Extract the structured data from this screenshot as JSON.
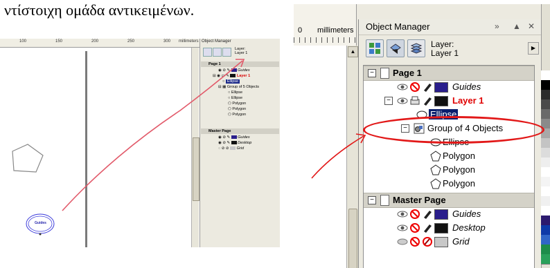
{
  "caption": "ντίστοιχη ομάδα αντικειμένων.",
  "left_screenshot": {
    "ruler_numbers": [
      "100",
      "150",
      "200",
      "250",
      "300"
    ],
    "ruler_unit": "millimeters",
    "panel_title": "Object Manager",
    "layer_line1": "Layer:",
    "layer_line2": "Layer 1",
    "tree": {
      "page": "Page 1",
      "guides": "Guides",
      "layer": "Layer 1",
      "ellipse_selected": "Ellipse",
      "group": "Group of 5 Objects",
      "children": [
        "Ellipse",
        "Ellipse",
        "Polygon",
        "Polygon",
        "Polygon"
      ],
      "master": "Master Page",
      "master_items": [
        "Guides",
        "Desktop",
        "Grid"
      ]
    },
    "canvas_label": "Guides"
  },
  "right_screenshot": {
    "ruler_number": "0",
    "ruler_unit": "millimeters",
    "panel_title": "Object Manager",
    "title_buttons": [
      "»",
      "▲",
      "✕"
    ],
    "layer_line1": "Layer:",
    "layer_line2": "Layer 1",
    "tree": {
      "page": "Page 1",
      "guides": "Guides",
      "layer": "Layer 1",
      "ellipse_selected": "Ellipse",
      "group": "Group of 4 Objects",
      "children": [
        "Ellipse",
        "Polygon",
        "Polygon",
        "Polygon"
      ],
      "master": "Master Page",
      "master_items": [
        "Guides",
        "Desktop",
        "Grid"
      ]
    }
  },
  "colors": {
    "accent_red": "#e21818",
    "selection_blue": "#0a1f6e",
    "guides_swatch": "#2a1e8c",
    "layer_swatch": "#111111",
    "grid_swatch": "#c8c8c8",
    "layer_text_red": "#e00000"
  },
  "icons": [
    "eye-icon",
    "no-print-icon",
    "pencil-icon",
    "expand-icon",
    "page-icon",
    "ellipse-icon",
    "polygon-icon",
    "group-icon"
  ]
}
